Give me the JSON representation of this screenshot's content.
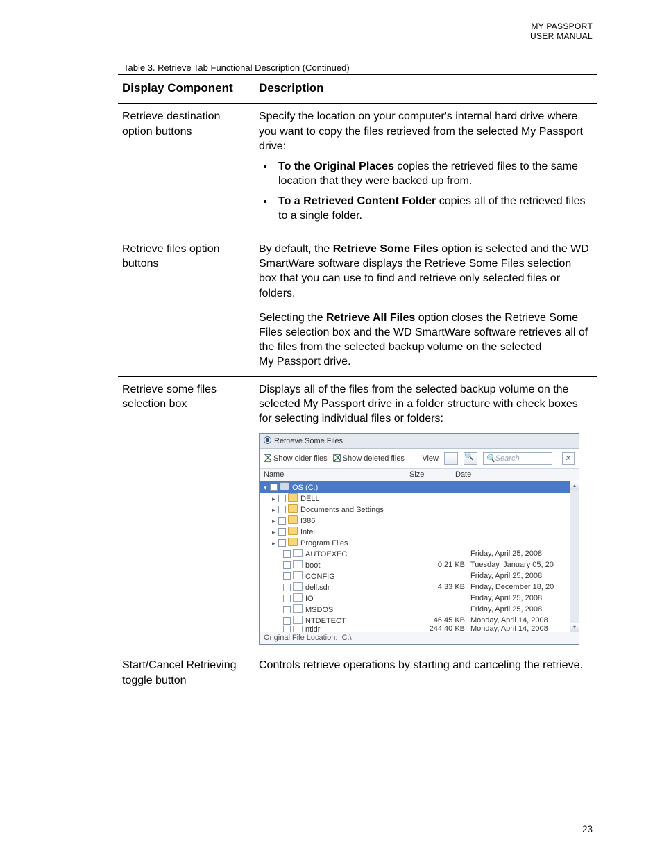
{
  "header": {
    "line1": "MY PASSPORT",
    "line2": "USER MANUAL"
  },
  "caption": "Table 3.  Retrieve Tab Functional Description (Continued)",
  "th1": "Display Component",
  "th2": "Description",
  "row1": {
    "label": "Retrieve destination option buttons",
    "intro": "Specify the location on your computer's internal hard drive where you want to copy the files retrieved from the selected My Passport drive:",
    "b1_bold": "To the Original Places",
    "b1_rest": " copies the retrieved files to the same location that they were backed up from.",
    "b2_bold": "To a Retrieved Content Folder",
    "b2_rest": " copies all of the retrieved files to a single folder."
  },
  "row2": {
    "label": "Retrieve files option buttons",
    "p1a": "By default, the ",
    "p1b": "Retrieve Some Files",
    "p1c": " option is selected and the WD SmartWare software displays the Retrieve Some Files selection box that you can use to find and retrieve only selected files or folders.",
    "p2a": "Selecting the ",
    "p2b": "Retrieve All Files",
    "p2c": " option closes the Retrieve Some Files selection box and the WD SmartWare software retrieves all of the files from the selected backup volume on the selected My Passport drive."
  },
  "row3": {
    "label": "Retrieve some files selection box",
    "desc": "Displays all of the files from the selected backup volume on the selected My Passport drive in a folder structure with check boxes for selecting individual files or folders:"
  },
  "row4": {
    "label": "Start/Cancel Retrieving toggle button",
    "desc": "Controls retrieve operations by starting and canceling the retrieve."
  },
  "embed": {
    "title": "Retrieve Some Files",
    "show_older": "Show older files",
    "show_deleted": "Show deleted files",
    "view": "View",
    "search_placeholder": "Search",
    "cols": {
      "name": "Name",
      "size": "Size",
      "date": "Date"
    },
    "rows": [
      {
        "type": "drive",
        "sel": true,
        "chev": "▾",
        "name": "OS (C:)",
        "size": "",
        "date": ""
      },
      {
        "type": "folder",
        "chev": "▸",
        "name": "DELL",
        "size": "",
        "date": ""
      },
      {
        "type": "folder",
        "chev": "▸",
        "name": "Documents and Settings",
        "size": "",
        "date": ""
      },
      {
        "type": "folder",
        "chev": "▸",
        "name": "I386",
        "size": "",
        "date": ""
      },
      {
        "type": "folder",
        "chev": "▸",
        "name": "Intel",
        "size": "",
        "date": ""
      },
      {
        "type": "folder",
        "chev": "▸",
        "name": "Program Files",
        "size": "",
        "date": ""
      },
      {
        "type": "file",
        "name": "AUTOEXEC",
        "size": "",
        "date": "Friday, April 25, 2008"
      },
      {
        "type": "file",
        "name": "boot",
        "size": "0.21 KB",
        "date": "Tuesday, January 05, 20"
      },
      {
        "type": "file",
        "name": "CONFIG",
        "size": "",
        "date": "Friday, April 25, 2008"
      },
      {
        "type": "file",
        "name": "dell.sdr",
        "size": "4.33 KB",
        "date": "Friday, December 18, 20"
      },
      {
        "type": "file",
        "name": "IO",
        "size": "",
        "date": "Friday, April 25, 2008"
      },
      {
        "type": "file",
        "name": "MSDOS",
        "size": "",
        "date": "Friday, April 25, 2008"
      },
      {
        "type": "file",
        "name": "NTDETECT",
        "size": "46.45 KB",
        "date": "Monday, April 14, 2008"
      },
      {
        "type": "file",
        "name": "ntldr",
        "size": "244.40 KB",
        "date": "Monday, April 14, 2008",
        "cut": true
      }
    ],
    "footer_label": "Original File Location:",
    "footer_value": "C:\\"
  },
  "page_number": "– 23"
}
